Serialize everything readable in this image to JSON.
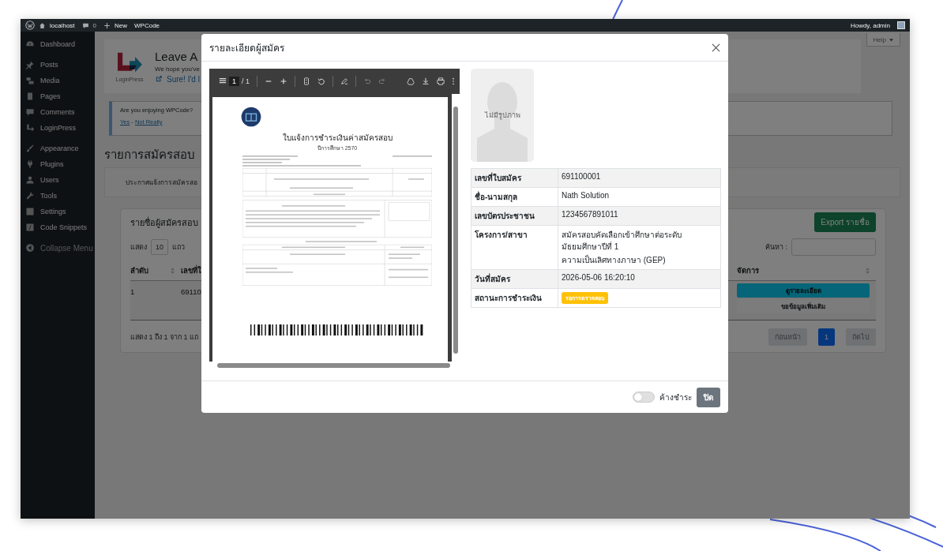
{
  "admin_bar": {
    "site": "localhost",
    "comments": "0",
    "new": "New",
    "plugin": "WPCode",
    "greeting": "Howdy, admin"
  },
  "sidebar": {
    "groups": [
      {
        "items": [
          {
            "label": "Dashboard",
            "kind": "dashboard"
          }
        ]
      },
      {
        "items": [
          {
            "label": "Posts",
            "kind": "pin"
          },
          {
            "label": "Media",
            "kind": "media"
          },
          {
            "label": "Pages",
            "kind": "pages"
          },
          {
            "label": "Comments",
            "kind": "comments"
          },
          {
            "label": "LoginPress",
            "kind": "loginpress"
          }
        ]
      },
      {
        "items": [
          {
            "label": "Appearance",
            "kind": "appearance"
          },
          {
            "label": "Plugins",
            "kind": "plugins"
          },
          {
            "label": "Users",
            "kind": "users"
          },
          {
            "label": "Tools",
            "kind": "tools"
          },
          {
            "label": "Settings",
            "kind": "settings"
          },
          {
            "label": "Code Snippets",
            "kind": "code"
          }
        ]
      }
    ],
    "collapse": "Collapse Menu"
  },
  "help_tab": "Help",
  "banner": {
    "logo_caption": "LoginPress",
    "title": "Leave A",
    "text": "We hope you've",
    "link": "Sure! I'd l"
  },
  "notice": {
    "question": "Are you enjoying WPCode?",
    "yes": "Yes",
    "separator": "-",
    "no": "Not Really"
  },
  "page_title": "รายการสมัครสอบ",
  "announcement": "ประกาศแจ้งการสมัครสอ",
  "applicants": {
    "title": "รายชื่อผู้สมัครสอบ",
    "export": "Export รายชื่อ",
    "show_label": "แสดง",
    "page_size": "10",
    "rows_label": "แถว",
    "search_label": "ค้นหา :",
    "columns": [
      "ลำดับ",
      "เลขที่ใ",
      "จัดการ"
    ],
    "rows": [
      {
        "no": "1",
        "app_no": "69110",
        "actions": [
          "ดูรายละเอียด",
          "ขอข้อมูลเพิ่มเติม"
        ]
      }
    ],
    "info": "แสดง 1 ถึง 1 จาก 1 แถ",
    "pagination": {
      "prev": "ก่อนหน้า",
      "pages": [
        {
          "label": "1",
          "selected": true
        }
      ],
      "next": "ถัดไป"
    }
  },
  "modal": {
    "title": "รายละเอียดผู้สมัคร",
    "pdf_viewer": {
      "page": "1",
      "page_count": "/ 1",
      "document": {
        "heading": "ใบแจ้งการชำระเงินค่าสมัครสอบ",
        "subheading": "ปีการศึกษา 2570"
      }
    },
    "photo": {
      "caption": "ไม่มีรูปภาพ"
    },
    "details": [
      {
        "label": "เลขที่ใบสมัคร",
        "kind": "text",
        "value": "691100001"
      },
      {
        "label": "ชื่อ-นามสกุล",
        "kind": "text",
        "value": "Nath Solution"
      },
      {
        "label": "เลขบัตรประชาชน",
        "kind": "text",
        "value": "1234567891011"
      },
      {
        "label": "โครงการ/สาขา",
        "kind": "lines",
        "lines": [
          "สมัครสอบคัดเลือกเข้าศึกษาต่อระดับมัธยมศึกษาปีที่ 1",
          "ความเป็นเลิศทางภาษา (GEP)"
        ]
      },
      {
        "label": "วันที่สมัคร",
        "kind": "text",
        "value": "2026-05-06 16:20:10"
      },
      {
        "label": "สถานะการชำระเงิน",
        "kind": "badge",
        "value": "รอการตรวจสอบ"
      }
    ],
    "footer": {
      "toggle": {
        "label": "ค้างชำระ",
        "on": false
      },
      "close_button": "ปิด"
    }
  }
}
